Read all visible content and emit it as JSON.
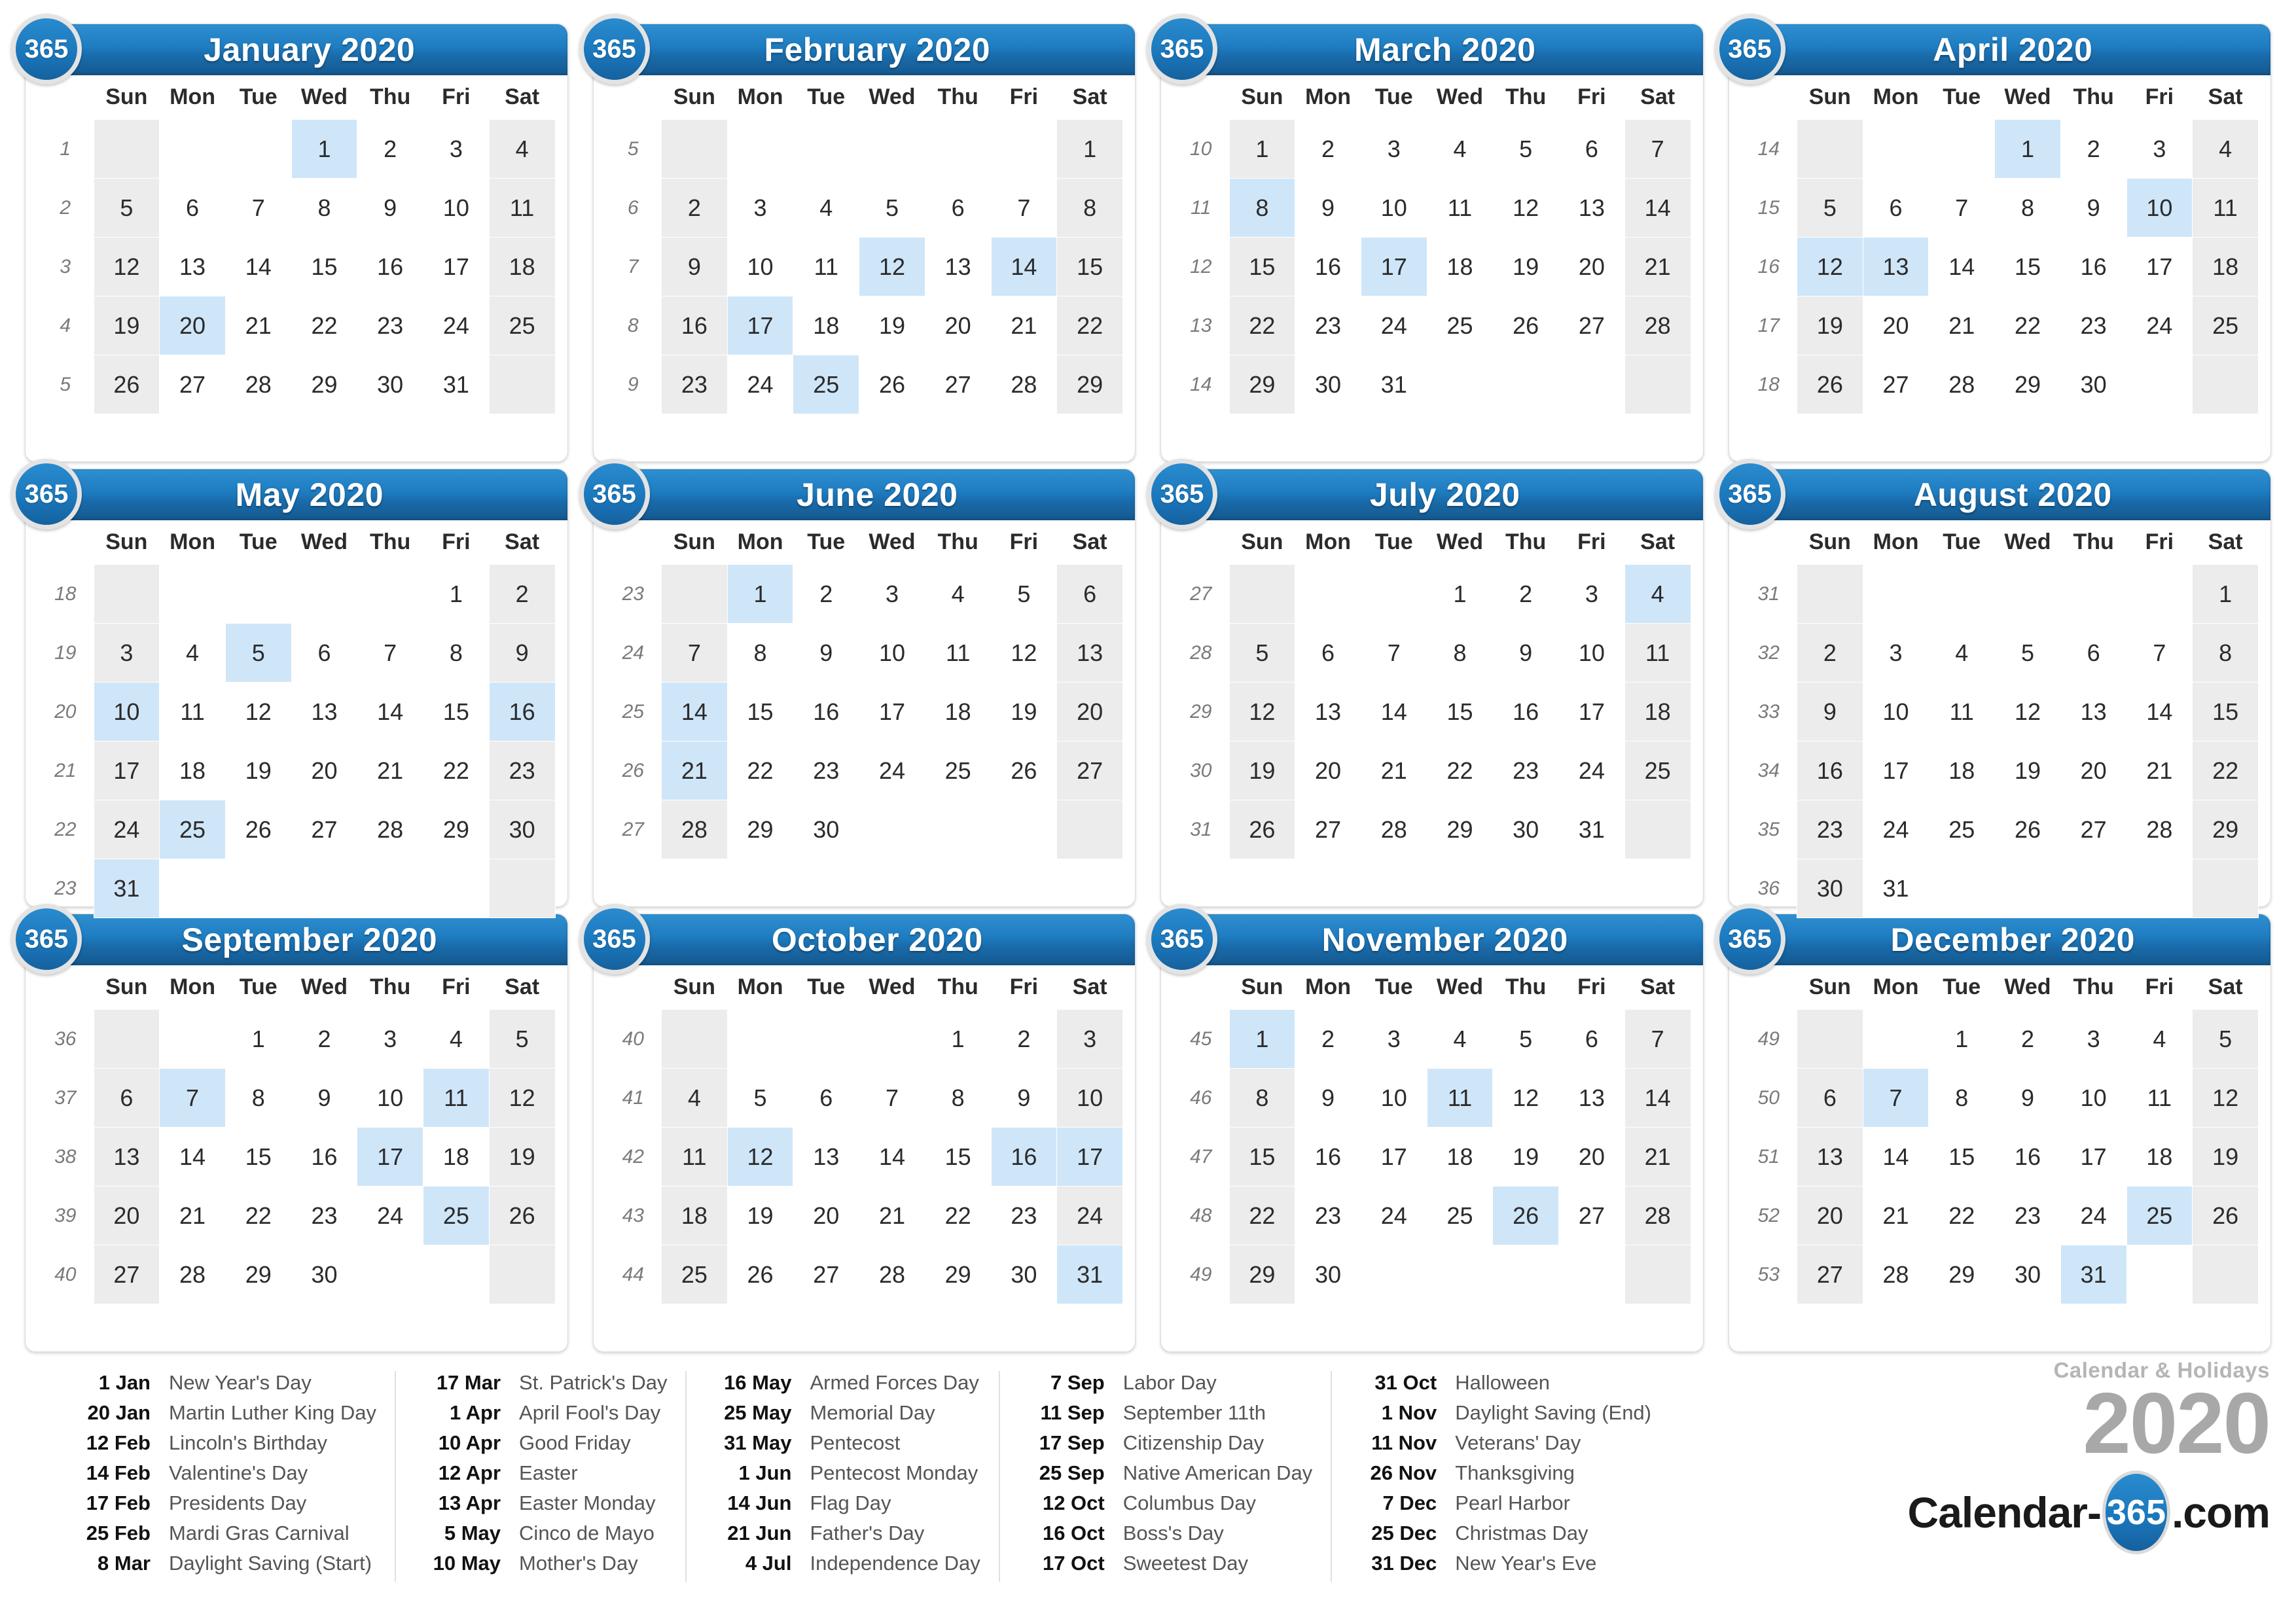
{
  "year": "2020",
  "badge_label": "365",
  "weekday_headers": [
    "Sun",
    "Mon",
    "Tue",
    "Wed",
    "Thu",
    "Fri",
    "Sat"
  ],
  "colors": {
    "header_blue": "#1b78bd",
    "highlight_blue": "#cfe6f9",
    "weekend_gray": "#ececec",
    "week_number_gray": "#7a7a7a",
    "brand_gray": "#a8a8a8"
  },
  "months": [
    {
      "title": "January 2020",
      "name": "January",
      "week_numbers": [
        "1",
        "2",
        "3",
        "4",
        "5"
      ],
      "weeks": [
        [
          "",
          "",
          "",
          "1",
          "2",
          "3",
          "4"
        ],
        [
          "5",
          "6",
          "7",
          "8",
          "9",
          "10",
          "11"
        ],
        [
          "12",
          "13",
          "14",
          "15",
          "16",
          "17",
          "18"
        ],
        [
          "19",
          "20",
          "21",
          "22",
          "23",
          "24",
          "25"
        ],
        [
          "26",
          "27",
          "28",
          "29",
          "30",
          "31",
          ""
        ]
      ],
      "highlights": [
        "1",
        "20"
      ]
    },
    {
      "title": "February 2020",
      "name": "February",
      "week_numbers": [
        "5",
        "6",
        "7",
        "8",
        "9"
      ],
      "weeks": [
        [
          "",
          "",
          "",
          "",
          "",
          "",
          "1"
        ],
        [
          "2",
          "3",
          "4",
          "5",
          "6",
          "7",
          "8"
        ],
        [
          "9",
          "10",
          "11",
          "12",
          "13",
          "14",
          "15"
        ],
        [
          "16",
          "17",
          "18",
          "19",
          "20",
          "21",
          "22"
        ],
        [
          "23",
          "24",
          "25",
          "26",
          "27",
          "28",
          "29"
        ]
      ],
      "highlights": [
        "12",
        "14",
        "17",
        "25"
      ]
    },
    {
      "title": "March 2020",
      "name": "March",
      "week_numbers": [
        "10",
        "11",
        "12",
        "13",
        "14"
      ],
      "weeks": [
        [
          "1",
          "2",
          "3",
          "4",
          "5",
          "6",
          "7"
        ],
        [
          "8",
          "9",
          "10",
          "11",
          "12",
          "13",
          "14"
        ],
        [
          "15",
          "16",
          "17",
          "18",
          "19",
          "20",
          "21"
        ],
        [
          "22",
          "23",
          "24",
          "25",
          "26",
          "27",
          "28"
        ],
        [
          "29",
          "30",
          "31",
          "",
          "",
          "",
          ""
        ]
      ],
      "highlights": [
        "8",
        "17"
      ]
    },
    {
      "title": "April 2020",
      "name": "April",
      "week_numbers": [
        "14",
        "15",
        "16",
        "17",
        "18"
      ],
      "weeks": [
        [
          "",
          "",
          "",
          "1",
          "2",
          "3",
          "4"
        ],
        [
          "5",
          "6",
          "7",
          "8",
          "9",
          "10",
          "11"
        ],
        [
          "12",
          "13",
          "14",
          "15",
          "16",
          "17",
          "18"
        ],
        [
          "19",
          "20",
          "21",
          "22",
          "23",
          "24",
          "25"
        ],
        [
          "26",
          "27",
          "28",
          "29",
          "30",
          "",
          ""
        ]
      ],
      "highlights": [
        "1",
        "10",
        "12",
        "13"
      ]
    },
    {
      "title": "May 2020",
      "name": "May",
      "week_numbers": [
        "18",
        "19",
        "20",
        "21",
        "22",
        "23"
      ],
      "weeks": [
        [
          "",
          "",
          "",
          "",
          "",
          "1",
          "2"
        ],
        [
          "3",
          "4",
          "5",
          "6",
          "7",
          "8",
          "9"
        ],
        [
          "10",
          "11",
          "12",
          "13",
          "14",
          "15",
          "16"
        ],
        [
          "17",
          "18",
          "19",
          "20",
          "21",
          "22",
          "23"
        ],
        [
          "24",
          "25",
          "26",
          "27",
          "28",
          "29",
          "30"
        ],
        [
          "31",
          "",
          "",
          "",
          "",
          "",
          ""
        ]
      ],
      "highlights": [
        "5",
        "10",
        "16",
        "25",
        "31"
      ]
    },
    {
      "title": "June 2020",
      "name": "June",
      "week_numbers": [
        "23",
        "24",
        "25",
        "26",
        "27"
      ],
      "weeks": [
        [
          "",
          "1",
          "2",
          "3",
          "4",
          "5",
          "6"
        ],
        [
          "7",
          "8",
          "9",
          "10",
          "11",
          "12",
          "13"
        ],
        [
          "14",
          "15",
          "16",
          "17",
          "18",
          "19",
          "20"
        ],
        [
          "21",
          "22",
          "23",
          "24",
          "25",
          "26",
          "27"
        ],
        [
          "28",
          "29",
          "30",
          "",
          "",
          "",
          ""
        ]
      ],
      "highlights": [
        "1",
        "14",
        "21"
      ]
    },
    {
      "title": "July 2020",
      "name": "July",
      "week_numbers": [
        "27",
        "28",
        "29",
        "30",
        "31"
      ],
      "weeks": [
        [
          "",
          "",
          "",
          "1",
          "2",
          "3",
          "4"
        ],
        [
          "5",
          "6",
          "7",
          "8",
          "9",
          "10",
          "11"
        ],
        [
          "12",
          "13",
          "14",
          "15",
          "16",
          "17",
          "18"
        ],
        [
          "19",
          "20",
          "21",
          "22",
          "23",
          "24",
          "25"
        ],
        [
          "26",
          "27",
          "28",
          "29",
          "30",
          "31",
          ""
        ]
      ],
      "highlights": [
        "4"
      ]
    },
    {
      "title": "August 2020",
      "name": "August",
      "week_numbers": [
        "31",
        "32",
        "33",
        "34",
        "35",
        "36"
      ],
      "weeks": [
        [
          "",
          "",
          "",
          "",
          "",
          "",
          "1"
        ],
        [
          "2",
          "3",
          "4",
          "5",
          "6",
          "7",
          "8"
        ],
        [
          "9",
          "10",
          "11",
          "12",
          "13",
          "14",
          "15"
        ],
        [
          "16",
          "17",
          "18",
          "19",
          "20",
          "21",
          "22"
        ],
        [
          "23",
          "24",
          "25",
          "26",
          "27",
          "28",
          "29"
        ],
        [
          "30",
          "31",
          "",
          "",
          "",
          "",
          ""
        ]
      ],
      "highlights": []
    },
    {
      "title": "September 2020",
      "name": "September",
      "week_numbers": [
        "36",
        "37",
        "38",
        "39",
        "40"
      ],
      "weeks": [
        [
          "",
          "",
          "1",
          "2",
          "3",
          "4",
          "5"
        ],
        [
          "6",
          "7",
          "8",
          "9",
          "10",
          "11",
          "12"
        ],
        [
          "13",
          "14",
          "15",
          "16",
          "17",
          "18",
          "19"
        ],
        [
          "20",
          "21",
          "22",
          "23",
          "24",
          "25",
          "26"
        ],
        [
          "27",
          "28",
          "29",
          "30",
          "",
          "",
          ""
        ]
      ],
      "highlights": [
        "7",
        "11",
        "17",
        "25"
      ]
    },
    {
      "title": "October 2020",
      "name": "October",
      "week_numbers": [
        "40",
        "41",
        "42",
        "43",
        "44"
      ],
      "weeks": [
        [
          "",
          "",
          "",
          "",
          "1",
          "2",
          "3"
        ],
        [
          "4",
          "5",
          "6",
          "7",
          "8",
          "9",
          "10"
        ],
        [
          "11",
          "12",
          "13",
          "14",
          "15",
          "16",
          "17"
        ],
        [
          "18",
          "19",
          "20",
          "21",
          "22",
          "23",
          "24"
        ],
        [
          "25",
          "26",
          "27",
          "28",
          "29",
          "30",
          "31"
        ]
      ],
      "highlights": [
        "12",
        "16",
        "17",
        "31"
      ]
    },
    {
      "title": "November 2020",
      "name": "November",
      "week_numbers": [
        "45",
        "46",
        "47",
        "48",
        "49"
      ],
      "weeks": [
        [
          "1",
          "2",
          "3",
          "4",
          "5",
          "6",
          "7"
        ],
        [
          "8",
          "9",
          "10",
          "11",
          "12",
          "13",
          "14"
        ],
        [
          "15",
          "16",
          "17",
          "18",
          "19",
          "20",
          "21"
        ],
        [
          "22",
          "23",
          "24",
          "25",
          "26",
          "27",
          "28"
        ],
        [
          "29",
          "30",
          "",
          "",
          "",
          "",
          ""
        ]
      ],
      "highlights": [
        "1",
        "11",
        "26"
      ]
    },
    {
      "title": "December 2020",
      "name": "December",
      "week_numbers": [
        "49",
        "50",
        "51",
        "52",
        "53"
      ],
      "weeks": [
        [
          "",
          "",
          "1",
          "2",
          "3",
          "4",
          "5"
        ],
        [
          "6",
          "7",
          "8",
          "9",
          "10",
          "11",
          "12"
        ],
        [
          "13",
          "14",
          "15",
          "16",
          "17",
          "18",
          "19"
        ],
        [
          "20",
          "21",
          "22",
          "23",
          "24",
          "25",
          "26"
        ],
        [
          "27",
          "28",
          "29",
          "30",
          "31",
          "",
          ""
        ]
      ],
      "highlights": [
        "7",
        "25",
        "31"
      ]
    }
  ],
  "legend_columns": [
    [
      {
        "date": "1 Jan",
        "name": "New Year's Day"
      },
      {
        "date": "20 Jan",
        "name": "Martin Luther King Day"
      },
      {
        "date": "12 Feb",
        "name": "Lincoln's Birthday"
      },
      {
        "date": "14 Feb",
        "name": "Valentine's Day"
      },
      {
        "date": "17 Feb",
        "name": "Presidents Day"
      },
      {
        "date": "25 Feb",
        "name": "Mardi Gras Carnival"
      },
      {
        "date": "8 Mar",
        "name": "Daylight Saving (Start)"
      }
    ],
    [
      {
        "date": "17 Mar",
        "name": "St. Patrick's Day"
      },
      {
        "date": "1 Apr",
        "name": "April Fool's Day"
      },
      {
        "date": "10 Apr",
        "name": "Good Friday"
      },
      {
        "date": "12 Apr",
        "name": "Easter"
      },
      {
        "date": "13 Apr",
        "name": "Easter Monday"
      },
      {
        "date": "5 May",
        "name": "Cinco de Mayo"
      },
      {
        "date": "10 May",
        "name": "Mother's Day"
      }
    ],
    [
      {
        "date": "16 May",
        "name": "Armed Forces Day"
      },
      {
        "date": "25 May",
        "name": "Memorial Day"
      },
      {
        "date": "31 May",
        "name": "Pentecost"
      },
      {
        "date": "1 Jun",
        "name": "Pentecost Monday"
      },
      {
        "date": "14 Jun",
        "name": "Flag Day"
      },
      {
        "date": "21 Jun",
        "name": "Father's Day"
      },
      {
        "date": "4 Jul",
        "name": "Independence Day"
      }
    ],
    [
      {
        "date": "7 Sep",
        "name": "Labor Day"
      },
      {
        "date": "11 Sep",
        "name": "September 11th"
      },
      {
        "date": "17 Sep",
        "name": "Citizenship Day"
      },
      {
        "date": "25 Sep",
        "name": "Native American Day"
      },
      {
        "date": "12 Oct",
        "name": "Columbus Day"
      },
      {
        "date": "16 Oct",
        "name": "Boss's Day"
      },
      {
        "date": "17 Oct",
        "name": "Sweetest Day"
      }
    ],
    [
      {
        "date": "31 Oct",
        "name": "Halloween"
      },
      {
        "date": "1 Nov",
        "name": "Daylight Saving (End)"
      },
      {
        "date": "11 Nov",
        "name": "Veterans' Day"
      },
      {
        "date": "26 Nov",
        "name": "Thanksgiving"
      },
      {
        "date": "7 Dec",
        "name": "Pearl Harbor"
      },
      {
        "date": "25 Dec",
        "name": "Christmas Day"
      },
      {
        "date": "31 Dec",
        "name": "New Year's Eve"
      }
    ]
  ],
  "branding": {
    "subtitle": "Calendar & Holidays",
    "year": "2020",
    "logo_word1": "Calendar-",
    "logo_badge": "365",
    "logo_word2": ".com"
  }
}
